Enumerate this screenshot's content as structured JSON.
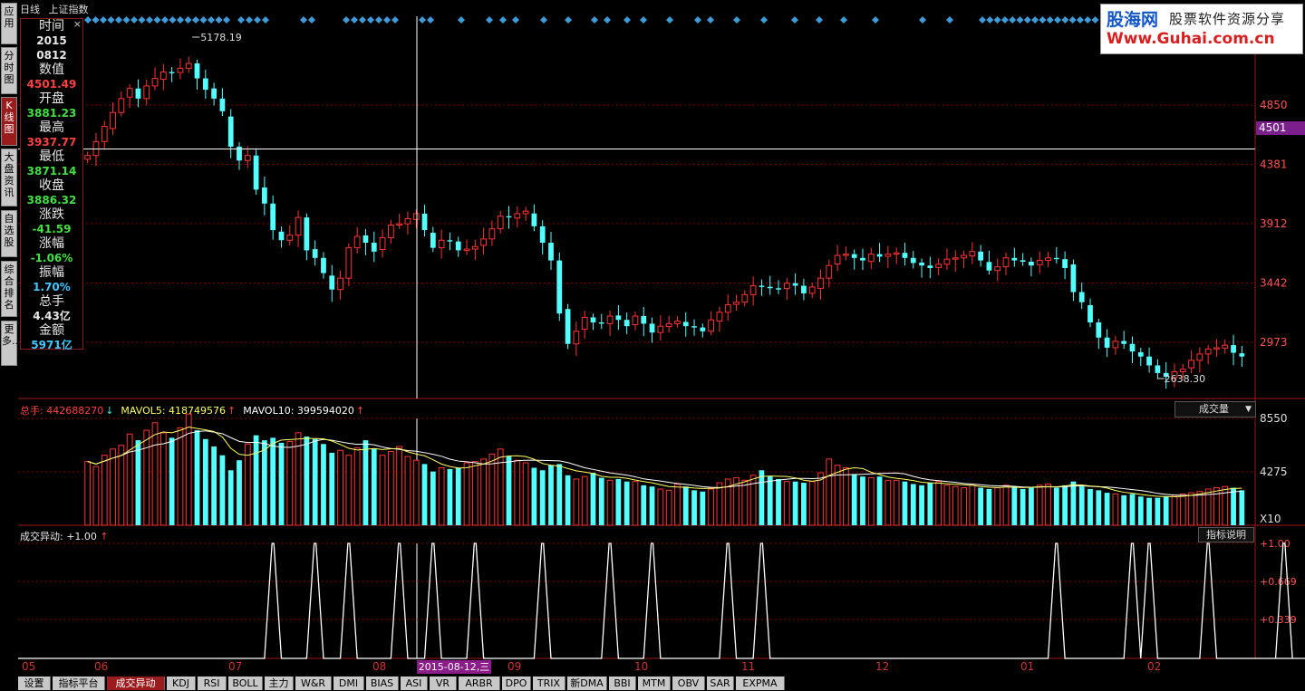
{
  "window": {
    "period": "日线",
    "symbol": "上证指数"
  },
  "sidebar": {
    "tabs": [
      {
        "label": "应用",
        "active": false
      },
      {
        "label": "分时图",
        "active": false
      },
      {
        "label": "K线图",
        "active": true
      },
      {
        "label": "大盘资讯",
        "active": false
      },
      {
        "label": "自选股",
        "active": false
      },
      {
        "label": "综合排名",
        "active": false
      },
      {
        "label": "更多..",
        "active": false
      }
    ]
  },
  "info_panel": {
    "close": "×",
    "rows": [
      {
        "label": "时间"
      },
      {
        "value": "2015",
        "color": "#e8e8e8"
      },
      {
        "value": "0812",
        "color": "#e8e8e8"
      },
      {
        "label": "数值"
      },
      {
        "value": "4501.49",
        "color": "#ff4040"
      },
      {
        "label": "开盘"
      },
      {
        "value": "3881.23",
        "color": "#40e040"
      },
      {
        "label": "最高"
      },
      {
        "value": "3937.77",
        "color": "#ff4040"
      },
      {
        "label": "最低"
      },
      {
        "value": "3871.14",
        "color": "#40e040"
      },
      {
        "label": "收盘"
      },
      {
        "value": "3886.32",
        "color": "#40e040"
      },
      {
        "label": "涨跌"
      },
      {
        "value": "-41.59",
        "color": "#40e040"
      },
      {
        "label": "涨幅"
      },
      {
        "value": "-1.06%",
        "color": "#40e040"
      },
      {
        "label": "振幅"
      },
      {
        "value": "1.70%",
        "color": "#40c8ff"
      },
      {
        "label": "总手"
      },
      {
        "value": "4.43亿",
        "color": "#e8e8e8"
      },
      {
        "label": "金额"
      },
      {
        "value": "5971亿",
        "color": "#40c8ff"
      }
    ]
  },
  "logo": {
    "name": "股海网",
    "slogan": "股票软件资源分享",
    "url": "Www.Guhai.com.cn"
  },
  "price_axis": {
    "labels": [
      "4850",
      "4381",
      "3912",
      "3442",
      "2973"
    ],
    "cursor_value": "4501"
  },
  "annotations": {
    "high": "5178.19",
    "low": "2638.30"
  },
  "volume": {
    "legend": [
      {
        "text": "总手: 442688270",
        "color": "#ff4040",
        "arrow": "↓",
        "arrow_color": "#40e0e0"
      },
      {
        "text": "MAVOL5: 418749576",
        "color": "#ffff60",
        "arrow": "↑",
        "arrow_color": "#ff4040"
      },
      {
        "text": "MAVOL10: 399594020",
        "color": "#ffffff",
        "arrow": "↑",
        "arrow_color": "#ff4040"
      }
    ],
    "selector": "成交量",
    "axis_labels": [
      "8550",
      "4275"
    ],
    "unit": "X10"
  },
  "indicator": {
    "legend_name": "成交异动: +1.00",
    "legend_arrow": "↑",
    "help_button": "指标说明",
    "axis_labels": [
      "+1.00",
      "+0.669",
      "+0.339"
    ]
  },
  "x_axis": {
    "months": [
      "05",
      "06",
      "07",
      "08",
      "09",
      "10",
      "11",
      "12",
      "01",
      "02"
    ],
    "cursor_date": "2015-08-12,三"
  },
  "bottom_tabs": [
    {
      "label": "设置",
      "active": false
    },
    {
      "label": "指标平台",
      "active": false
    },
    {
      "label": "成交异动",
      "active": true
    },
    {
      "label": "KDJ",
      "active": false
    },
    {
      "label": "RSI",
      "active": false
    },
    {
      "label": "BOLL",
      "active": false
    },
    {
      "label": "主力",
      "active": false
    },
    {
      "label": "W&R",
      "active": false
    },
    {
      "label": "DMI",
      "active": false
    },
    {
      "label": "BIAS",
      "active": false
    },
    {
      "label": "ASI",
      "active": false
    },
    {
      "label": "VR",
      "active": false
    },
    {
      "label": "ARBR",
      "active": false
    },
    {
      "label": "DPO",
      "active": false
    },
    {
      "label": "TRIX",
      "active": false
    },
    {
      "label": "新DMA",
      "active": false
    },
    {
      "label": "BBI",
      "active": false
    },
    {
      "label": "MTM",
      "active": false
    },
    {
      "label": "OBV",
      "active": false
    },
    {
      "label": "SAR",
      "active": false
    },
    {
      "label": "EXPMA",
      "active": false
    }
  ],
  "colors": {
    "up": "#ff3232",
    "down": "#54ffff",
    "grid": "#8b0000",
    "diamond": "#3c9bd8"
  },
  "chart_data": {
    "type": "candlestick",
    "price_range": [
      2600,
      5250
    ],
    "high_value": 5178.19,
    "low_value": 2638.3,
    "cursor_price": 4501.49,
    "closes": [
      4450,
      4560,
      4680,
      4790,
      4900,
      4980,
      4900,
      5000,
      5060,
      5110,
      5100,
      5140,
      5178,
      5060,
      4970,
      4900,
      4800,
      4520,
      4410,
      4450,
      4180,
      4070,
      3860,
      3780,
      3820,
      3960,
      3700,
      3640,
      3520,
      3390,
      3480,
      3720,
      3810,
      3760,
      3690,
      3800,
      3900,
      3910,
      3950,
      3990,
      3860,
      3720,
      3780,
      3770,
      3700,
      3710,
      3730,
      3790,
      3870,
      3970,
      3960,
      3990,
      4010,
      3890,
      3760,
      3620,
      3200,
      2960,
      3060,
      3170,
      3130,
      3120,
      3180,
      3150,
      3100,
      3180,
      3120,
      3050,
      3100,
      3120,
      3140,
      3100,
      3090,
      3060,
      3150,
      3210,
      3270,
      3290,
      3350,
      3420,
      3410,
      3400,
      3390,
      3440,
      3420,
      3360,
      3410,
      3480,
      3580,
      3660,
      3670,
      3640,
      3620,
      3670,
      3650,
      3670,
      3680,
      3640,
      3600,
      3580,
      3560,
      3590,
      3630,
      3640,
      3660,
      3690,
      3620,
      3540,
      3570,
      3640,
      3620,
      3610,
      3580,
      3620,
      3640,
      3630,
      3560,
      3370,
      3290,
      3130,
      3010,
      2930,
      2980,
      2960,
      2900,
      2860,
      2790,
      2730,
      2700,
      2740,
      2760,
      2830,
      2880,
      2920,
      2930,
      2950,
      2890,
      2860
    ],
    "volume_axis": [
      0,
      8550
    ],
    "volumes": [
      5100,
      4700,
      5600,
      6100,
      6400,
      7300,
      6800,
      7600,
      8200,
      7400,
      7000,
      7800,
      8900,
      7600,
      6900,
      6300,
      5600,
      4400,
      5200,
      6500,
      7200,
      6800,
      7000,
      6600,
      6700,
      7400,
      7100,
      6900,
      6500,
      5800,
      6000,
      5600,
      6200,
      6800,
      6100,
      5600,
      5900,
      6300,
      5500,
      5200,
      4900,
      4300,
      4600,
      4500,
      4600,
      5000,
      5100,
      5300,
      5700,
      6100,
      5500,
      5200,
      5000,
      4600,
      4400,
      4800,
      4900,
      4000,
      3700,
      3900,
      4200,
      3800,
      3600,
      3700,
      3500,
      3500,
      3200,
      3100,
      2900,
      2800,
      3300,
      3100,
      2800,
      2700,
      2900,
      3400,
      3700,
      3800,
      3600,
      4000,
      4400,
      3900,
      3700,
      3500,
      3500,
      3400,
      3500,
      4200,
      5300,
      4800,
      4600,
      4100,
      3900,
      3800,
      3900,
      3600,
      3600,
      3500,
      3300,
      3200,
      3400,
      3500,
      3200,
      3100,
      3000,
      3200,
      3000,
      2900,
      3000,
      3200,
      3100,
      2900,
      3000,
      3200,
      3300,
      3000,
      3200,
      3500,
      3100,
      2900,
      2800,
      2600,
      2500,
      2400,
      2500,
      2300,
      2200,
      2200,
      2300,
      2400,
      2500,
      2600,
      2700,
      2900,
      3000,
      3100,
      3000,
      2800
    ],
    "indicator_spikes": [
      22,
      27,
      31,
      37,
      41,
      46,
      54,
      62,
      67,
      76,
      80,
      115,
      124,
      126,
      133,
      142,
      159,
      164
    ]
  }
}
